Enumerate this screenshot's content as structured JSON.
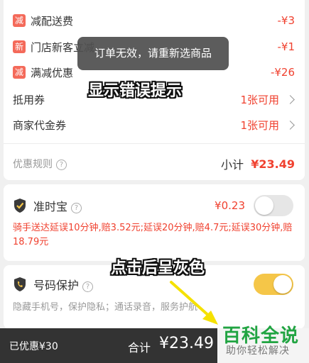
{
  "discounts": [
    {
      "badge": "减",
      "label": "减配送费",
      "value": "-¥3"
    },
    {
      "badge": "新",
      "label": "门店新客立减",
      "value": "-¥1"
    },
    {
      "badge": "减",
      "label": "满减优惠",
      "value": "-¥26"
    }
  ],
  "coupons": [
    {
      "label": "抵用券",
      "value": "1张可用"
    },
    {
      "label": "商家代金券",
      "value": "1张可用"
    }
  ],
  "rules": {
    "label": "优惠规则",
    "help": "?",
    "subtotal_label": "小计",
    "subtotal_value": "¥23.49"
  },
  "zhunshibao": {
    "title": "准时宝",
    "help": "?",
    "price": "¥0.23",
    "enabled": false,
    "desc": "骑手送达延误10分钟,赔3.52元;延误20分钟,赔4.7元;延误30分钟,赔18.79元"
  },
  "haoma": {
    "title": "号码保护",
    "help": "?",
    "enabled": true,
    "desc": "隐藏手机号，保护隐私；通话录音，服务护航"
  },
  "toast": "订单无效，请重新选商品",
  "annotations": {
    "error": "显示错误提示",
    "grey": "点击后呈灰色"
  },
  "bottom": {
    "saved": "已优惠¥30",
    "total_label": "合计",
    "total_value": "¥23.49"
  },
  "watermark": {
    "title": "百科全说",
    "subtitle": "助你轻松解决"
  },
  "colors": {
    "accent_red": "#f0412f",
    "badge_red": "#f46a5a",
    "toggle_on": "#f5c648",
    "bar": "#333333",
    "brand_green": "#21a442"
  },
  "icons": {
    "shield": "shield-check-icon",
    "phone_shield": "shield-phone-icon",
    "help": "help-circle-icon",
    "chevron": "chevron-right-icon"
  }
}
